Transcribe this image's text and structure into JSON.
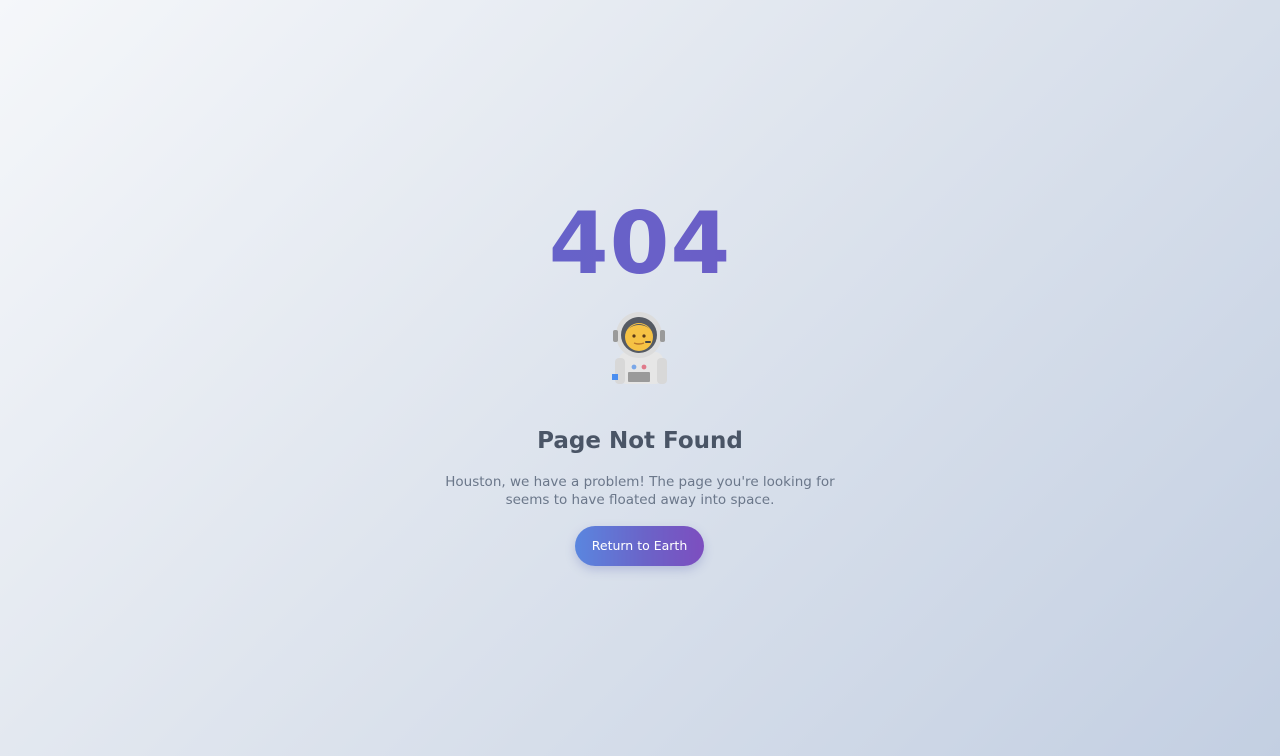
{
  "error": {
    "code": "404",
    "icon": "astronaut-icon",
    "title": "Page Not Found",
    "message": "Houston, we have a problem! The page you're looking for seems to have floated away into space."
  },
  "actions": {
    "primary_label": "Return to Earth"
  },
  "colors": {
    "background_start": "#f5f7fa",
    "background_end": "#c3cfe2",
    "accent_start": "#5a86df",
    "accent_end": "#7d4ebf",
    "title_text": "#4a5566",
    "body_text": "#6b778a"
  }
}
